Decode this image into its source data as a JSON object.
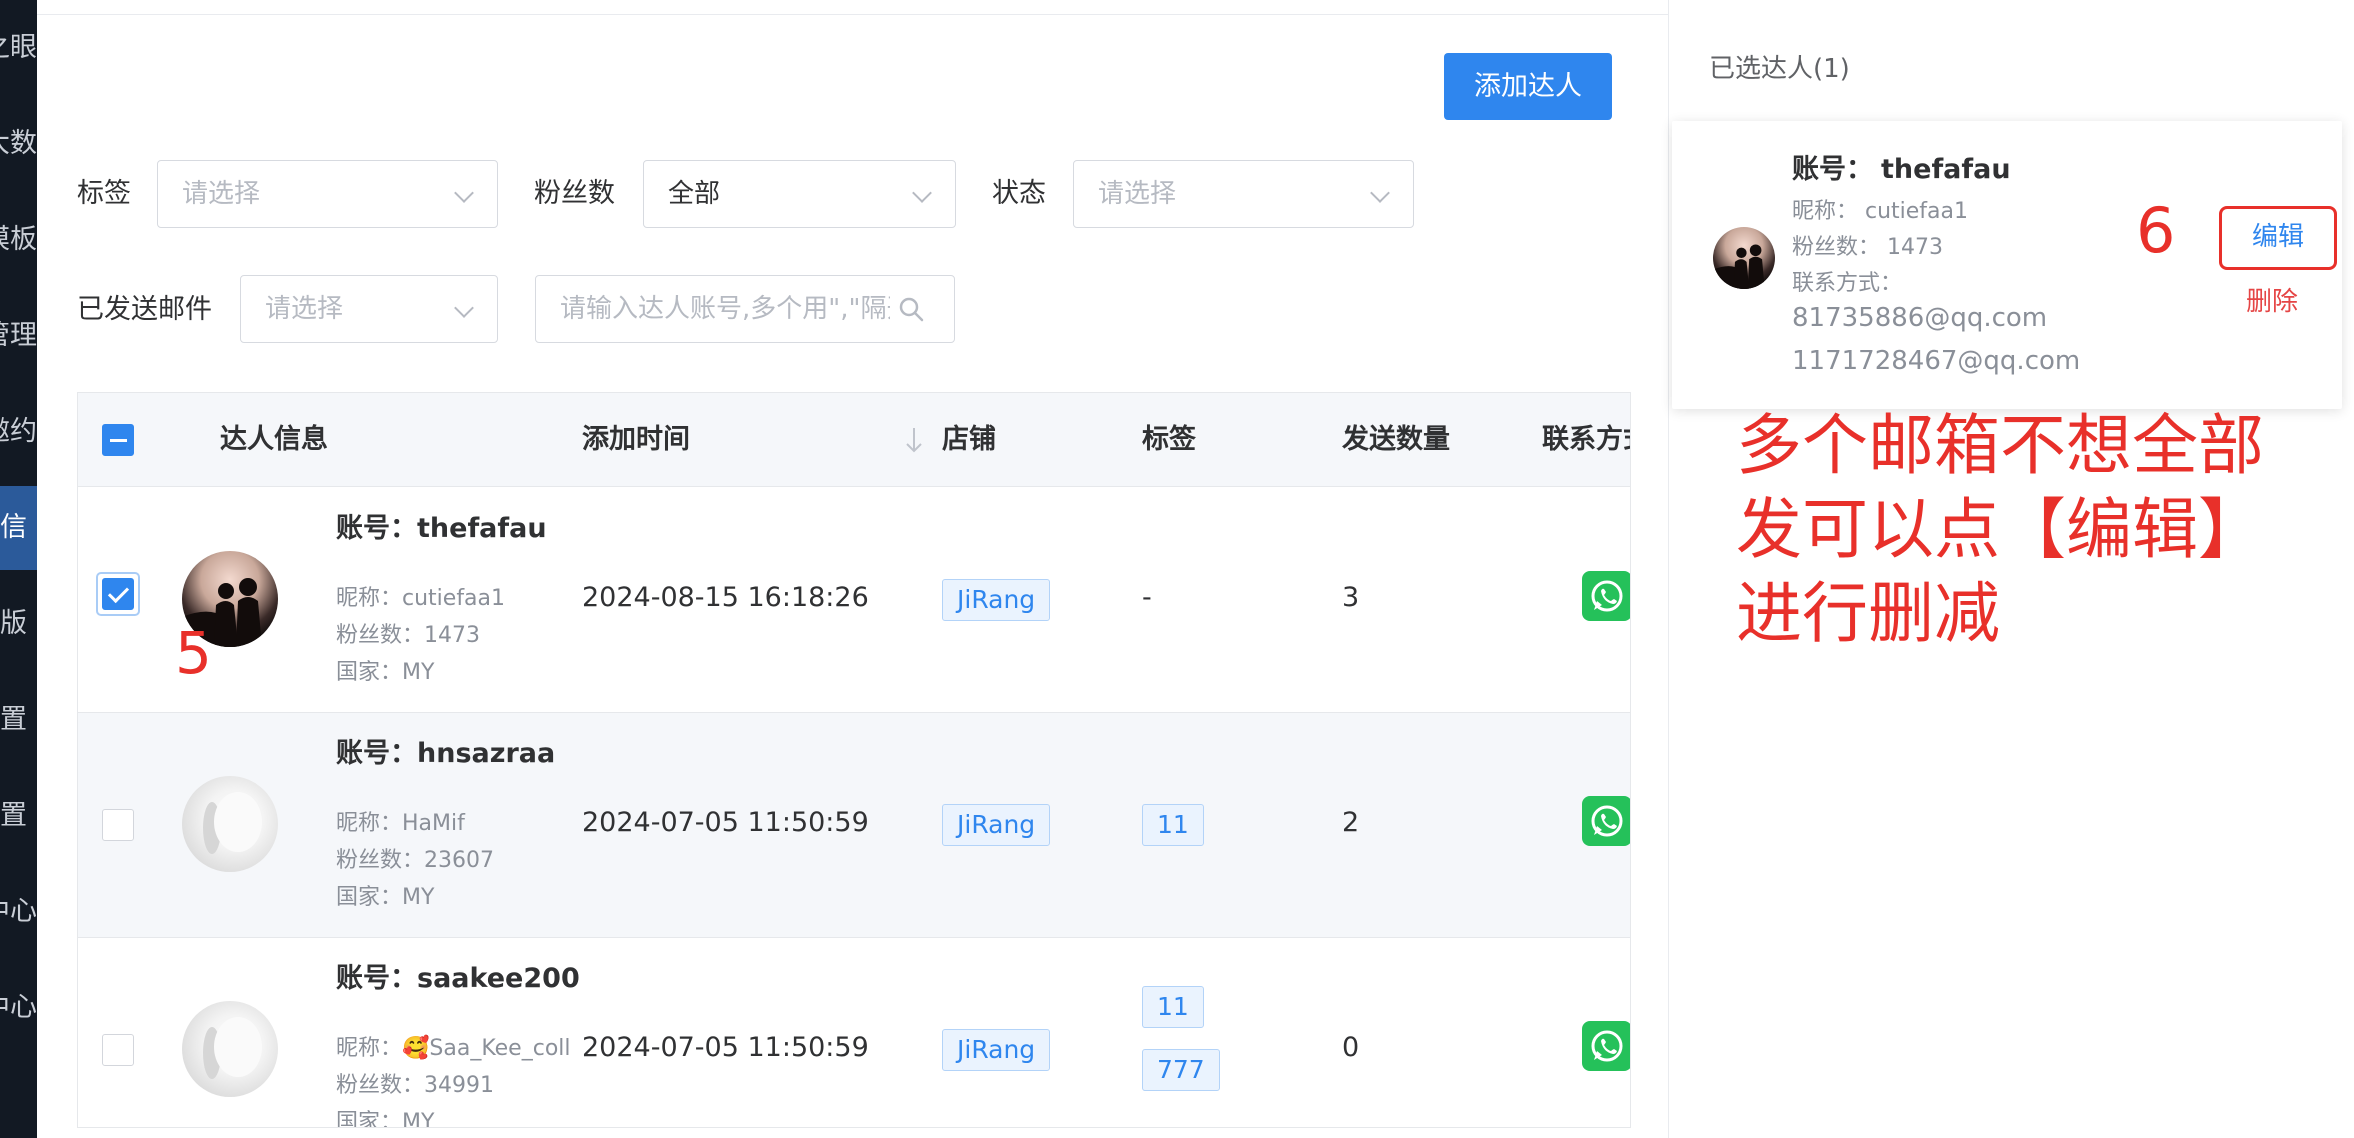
{
  "nav": {
    "items": [
      {
        "label": "之眼"
      },
      {
        "label": "大数"
      },
      {
        "label": "模板"
      },
      {
        "label": "管理"
      },
      {
        "label": "邀约"
      },
      {
        "label": "信"
      },
      {
        "label": "版"
      },
      {
        "label": "置"
      },
      {
        "label": "置"
      },
      {
        "label": "中心"
      },
      {
        "label": "中心"
      }
    ]
  },
  "toolbar": {
    "add_label": "添加达人"
  },
  "filters": {
    "tag_label": "标签",
    "tag_placeholder": "请选择",
    "fans_label": "粉丝数",
    "fans_value": "全部",
    "status_label": "状态",
    "status_placeholder": "请选择",
    "sent_label": "已发送邮件",
    "sent_placeholder": "请选择",
    "search_placeholder": "请输入达人账号,多个用\",\"隔开"
  },
  "table": {
    "headers": {
      "info": "达人信息",
      "added": "添加时间",
      "shop": "店铺",
      "tags": "标签",
      "sent": "发送数量",
      "contact": "联系方式"
    },
    "rows": [
      {
        "account": "账号：thefafau",
        "nickname": "昵称：cutiefaa1",
        "fans": "粉丝数：1473",
        "country": "国家：MY",
        "time": "2024-08-15 16:18:26",
        "shop": "JiRang",
        "tag_text": "-",
        "tags": [],
        "sent": "3",
        "checked": true
      },
      {
        "account": "账号：hnsazraa",
        "nickname": "昵称：HaMif",
        "fans": "粉丝数：23607",
        "country": "国家：MY",
        "time": "2024-07-05 11:50:59",
        "shop": "JiRang",
        "tag_text": "",
        "tags": [
          "11"
        ],
        "sent": "2",
        "checked": false
      },
      {
        "account": "账号：saakee200",
        "nickname": "昵称：🥰Saa_Kee_coll",
        "fans": "粉丝数：34991",
        "country": "国家：MY",
        "time": "2024-07-05 11:50:59",
        "shop": "JiRang",
        "tag_text": "",
        "tags": [
          "11",
          "777"
        ],
        "sent": "0",
        "checked": false
      }
    ]
  },
  "annotations": {
    "five": "5",
    "six": "6",
    "note_line1": "多个邮箱不想全部",
    "note_line2": "发可以点【编辑】",
    "note_line3": "进行删减"
  },
  "selected": {
    "title": "已选达人(1)",
    "account_label": "账号：",
    "account": "thefafau",
    "nickname": "昵称：  cutiefaa1",
    "fans": "粉丝数：  1473",
    "contact_label": "联系方式：",
    "emails": [
      "81735886@qq.com",
      "1171728467@qq.com"
    ],
    "edit_label": "编辑",
    "delete_label": "删除"
  },
  "colors": {
    "primary": "#2f86ee",
    "annotation": "#e8302a",
    "whatsapp": "#25c15a",
    "nav_bg": "#121923"
  }
}
